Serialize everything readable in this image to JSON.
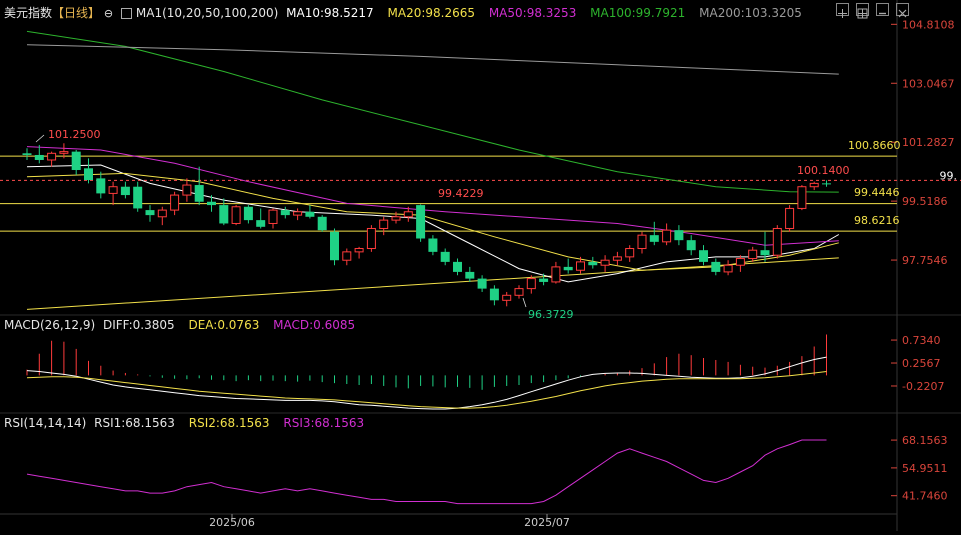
{
  "header": {
    "title": "美元指数",
    "period": "【日线】",
    "ma_title": "MA1(10,20,50,100,200)",
    "ma10": "MA10:98.5217",
    "ma20": "MA20:98.2665",
    "ma50": "MA50:98.3253",
    "ma100": "MA100:99.7921",
    "ma200": "MA200:103.3205"
  },
  "macd_header": {
    "title": "MACD(26,12,9)",
    "diff": "DIFF:0.3805",
    "dea": "DEA:0.0763",
    "macd": "MACD:0.6085"
  },
  "rsi_header": {
    "title": "RSI(14,14,14)",
    "rsi1": "RSI1:68.1563",
    "rsi2": "RSI2:68.1563",
    "rsi3": "RSI3:68.1563"
  },
  "colors": {
    "up": "#ff3b3b",
    "down": "#1fd185",
    "ma10": "#ffffff",
    "ma20": "#f2e04a",
    "ma50": "#d12fd1",
    "ma100": "#2db32d",
    "ma200": "#9a9a9a",
    "hline": "#f2e04a",
    "grid": "#2a2a2a"
  },
  "chart_data": [
    {
      "type": "candlestick",
      "name": "main",
      "x_labels": [
        "2025/06",
        "2025/07"
      ],
      "y_ticks": [
        "104.8108",
        "103.0467",
        "101.2827",
        "99.5186",
        "97.7546"
      ],
      "ylim": [
        96.2,
        105.0
      ],
      "annotations": [
        "101.2500",
        "99.4229",
        "96.3729",
        "100.1400",
        "100.8660",
        "99.4446",
        "98.6216"
      ],
      "horizontal_levels": [
        100.866,
        99.4446,
        98.6216
      ],
      "current_price": 100.14,
      "current_price_label": "99.",
      "support_trendline": {
        "from": [
          0,
          96.28
        ],
        "to": [
          66,
          97.82
        ]
      },
      "candles": [
        {
          "o": 100.95,
          "h": 101.1,
          "l": 100.75,
          "c": 100.9
        },
        {
          "o": 100.9,
          "h": 101.2,
          "l": 100.65,
          "c": 100.75
        },
        {
          "o": 100.75,
          "h": 101.0,
          "l": 100.55,
          "c": 100.95
        },
        {
          "o": 100.95,
          "h": 101.25,
          "l": 100.8,
          "c": 101.0
        },
        {
          "o": 101.0,
          "h": 101.05,
          "l": 100.3,
          "c": 100.45
        },
        {
          "o": 100.5,
          "h": 100.8,
          "l": 100.05,
          "c": 100.15
        },
        {
          "o": 100.2,
          "h": 100.4,
          "l": 99.6,
          "c": 99.75
        },
        {
          "o": 99.75,
          "h": 100.1,
          "l": 99.4,
          "c": 99.95
        },
        {
          "o": 99.95,
          "h": 100.1,
          "l": 99.6,
          "c": 99.7
        },
        {
          "o": 99.95,
          "h": 100.1,
          "l": 99.2,
          "c": 99.3
        },
        {
          "o": 99.25,
          "h": 99.4,
          "l": 98.9,
          "c": 99.1
        },
        {
          "o": 99.05,
          "h": 99.35,
          "l": 98.8,
          "c": 99.25
        },
        {
          "o": 99.25,
          "h": 99.8,
          "l": 99.1,
          "c": 99.7
        },
        {
          "o": 99.7,
          "h": 100.2,
          "l": 99.5,
          "c": 100.0
        },
        {
          "o": 100.0,
          "h": 100.55,
          "l": 99.4,
          "c": 99.5
        },
        {
          "o": 99.5,
          "h": 99.7,
          "l": 99.2,
          "c": 99.4
        },
        {
          "o": 99.4,
          "h": 99.6,
          "l": 98.8,
          "c": 98.85
        },
        {
          "o": 98.85,
          "h": 99.4,
          "l": 98.8,
          "c": 99.35
        },
        {
          "o": 99.35,
          "h": 99.4,
          "l": 98.85,
          "c": 98.95
        },
        {
          "o": 98.95,
          "h": 99.3,
          "l": 98.7,
          "c": 98.75
        },
        {
          "o": 98.85,
          "h": 99.3,
          "l": 98.7,
          "c": 99.25
        },
        {
          "o": 99.25,
          "h": 99.35,
          "l": 99.0,
          "c": 99.1
        },
        {
          "o": 99.1,
          "h": 99.3,
          "l": 98.95,
          "c": 99.2
        },
        {
          "o": 99.2,
          "h": 99.4,
          "l": 99.0,
          "c": 99.05
        },
        {
          "o": 99.05,
          "h": 99.1,
          "l": 98.6,
          "c": 98.65
        },
        {
          "o": 98.6,
          "h": 98.7,
          "l": 97.6,
          "c": 97.75
        },
        {
          "o": 97.75,
          "h": 98.1,
          "l": 97.6,
          "c": 98.0
        },
        {
          "o": 98.0,
          "h": 98.15,
          "l": 97.8,
          "c": 98.1
        },
        {
          "o": 98.1,
          "h": 98.8,
          "l": 98.0,
          "c": 98.7
        },
        {
          "o": 98.7,
          "h": 99.05,
          "l": 98.5,
          "c": 98.95
        },
        {
          "o": 98.95,
          "h": 99.2,
          "l": 98.85,
          "c": 99.05
        },
        {
          "o": 99.05,
          "h": 99.35,
          "l": 98.9,
          "c": 99.2
        },
        {
          "o": 99.4,
          "h": 99.42,
          "l": 98.3,
          "c": 98.4
        },
        {
          "o": 98.4,
          "h": 98.5,
          "l": 97.9,
          "c": 98.0
        },
        {
          "o": 98.0,
          "h": 98.1,
          "l": 97.6,
          "c": 97.7
        },
        {
          "o": 97.7,
          "h": 97.8,
          "l": 97.3,
          "c": 97.4
        },
        {
          "o": 97.4,
          "h": 97.55,
          "l": 97.1,
          "c": 97.2
        },
        {
          "o": 97.2,
          "h": 97.3,
          "l": 96.8,
          "c": 96.9
        },
        {
          "o": 96.9,
          "h": 97.0,
          "l": 96.4,
          "c": 96.55
        },
        {
          "o": 96.55,
          "h": 96.8,
          "l": 96.37,
          "c": 96.7
        },
        {
          "o": 96.7,
          "h": 97.0,
          "l": 96.6,
          "c": 96.9
        },
        {
          "o": 96.9,
          "h": 97.3,
          "l": 96.75,
          "c": 97.2
        },
        {
          "o": 97.2,
          "h": 97.35,
          "l": 97.0,
          "c": 97.1
        },
        {
          "o": 97.1,
          "h": 97.7,
          "l": 97.05,
          "c": 97.55
        },
        {
          "o": 97.55,
          "h": 97.8,
          "l": 97.35,
          "c": 97.45
        },
        {
          "o": 97.45,
          "h": 97.85,
          "l": 97.35,
          "c": 97.7
        },
        {
          "o": 97.7,
          "h": 97.85,
          "l": 97.5,
          "c": 97.6
        },
        {
          "o": 97.6,
          "h": 97.9,
          "l": 97.4,
          "c": 97.75
        },
        {
          "o": 97.75,
          "h": 98.0,
          "l": 97.6,
          "c": 97.85
        },
        {
          "o": 97.85,
          "h": 98.2,
          "l": 97.7,
          "c": 98.1
        },
        {
          "o": 98.1,
          "h": 98.6,
          "l": 97.95,
          "c": 98.5
        },
        {
          "o": 98.5,
          "h": 98.9,
          "l": 98.2,
          "c": 98.3
        },
        {
          "o": 98.3,
          "h": 98.85,
          "l": 98.2,
          "c": 98.65
        },
        {
          "o": 98.65,
          "h": 98.8,
          "l": 98.2,
          "c": 98.35
        },
        {
          "o": 98.35,
          "h": 98.5,
          "l": 97.9,
          "c": 98.05
        },
        {
          "o": 98.05,
          "h": 98.2,
          "l": 97.6,
          "c": 97.7
        },
        {
          "o": 97.7,
          "h": 97.8,
          "l": 97.3,
          "c": 97.4
        },
        {
          "o": 97.4,
          "h": 97.75,
          "l": 97.3,
          "c": 97.6
        },
        {
          "o": 97.6,
          "h": 97.9,
          "l": 97.4,
          "c": 97.8
        },
        {
          "o": 97.8,
          "h": 98.15,
          "l": 97.7,
          "c": 98.05
        },
        {
          "o": 98.05,
          "h": 98.6,
          "l": 97.7,
          "c": 97.9
        },
        {
          "o": 97.9,
          "h": 98.8,
          "l": 97.8,
          "c": 98.7
        },
        {
          "o": 98.7,
          "h": 99.4,
          "l": 98.6,
          "c": 99.3
        },
        {
          "o": 99.3,
          "h": 100.0,
          "l": 99.25,
          "c": 99.95
        },
        {
          "o": 99.95,
          "h": 100.1,
          "l": 99.85,
          "c": 100.05
        },
        {
          "o": 100.05,
          "h": 100.14,
          "l": 99.95,
          "c": 100.02
        }
      ],
      "ma_series": [
        {
          "name": "MA10",
          "color": "#ffffff",
          "points": [
            [
              0,
              100.55
            ],
            [
              6,
              100.6
            ],
            [
              10,
              100.05
            ],
            [
              16,
              99.55
            ],
            [
              22,
              99.2
            ],
            [
              28,
              99.1
            ],
            [
              32,
              99.0
            ],
            [
              36,
              98.25
            ],
            [
              40,
              97.5
            ],
            [
              44,
              97.1
            ],
            [
              48,
              97.35
            ],
            [
              52,
              97.7
            ],
            [
              56,
              97.85
            ],
            [
              60,
              97.85
            ],
            [
              64,
              98.1
            ],
            [
              66,
              98.52
            ]
          ]
        },
        {
          "name": "MA20",
          "color": "#f2e04a",
          "points": [
            [
              0,
              100.25
            ],
            [
              8,
              100.35
            ],
            [
              14,
              100.1
            ],
            [
              20,
              99.6
            ],
            [
              26,
              99.2
            ],
            [
              32,
              99.1
            ],
            [
              38,
              98.45
            ],
            [
              44,
              97.85
            ],
            [
              50,
              97.45
            ],
            [
              56,
              97.55
            ],
            [
              62,
              97.9
            ],
            [
              66,
              98.27
            ]
          ]
        },
        {
          "name": "MA50",
          "color": "#d12fd1",
          "points": [
            [
              0,
              101.15
            ],
            [
              6,
              101.05
            ],
            [
              12,
              100.65
            ],
            [
              18,
              100.1
            ],
            [
              26,
              99.45
            ],
            [
              34,
              99.2
            ],
            [
              40,
              99.05
            ],
            [
              48,
              98.85
            ],
            [
              54,
              98.55
            ],
            [
              60,
              98.2
            ],
            [
              66,
              98.33
            ]
          ]
        },
        {
          "name": "MA100",
          "color": "#2db32d",
          "points": [
            [
              0,
              104.6
            ],
            [
              8,
              104.15
            ],
            [
              16,
              103.4
            ],
            [
              24,
              102.55
            ],
            [
              32,
              101.8
            ],
            [
              40,
              101.05
            ],
            [
              48,
              100.4
            ],
            [
              56,
              99.95
            ],
            [
              62,
              99.8
            ],
            [
              66,
              99.79
            ]
          ]
        },
        {
          "name": "MA200",
          "color": "#9a9a9a",
          "points": [
            [
              0,
              104.2
            ],
            [
              16,
              104.05
            ],
            [
              32,
              103.85
            ],
            [
              48,
              103.6
            ],
            [
              66,
              103.32
            ]
          ]
        }
      ]
    },
    {
      "type": "bar+line",
      "name": "macd",
      "y_ticks": [
        "0.7340",
        "0.2567",
        "-0.2207"
      ],
      "ylim": [
        -0.72,
        0.86
      ],
      "histogram": [
        0.12,
        0.45,
        0.72,
        0.7,
        0.55,
        0.3,
        0.2,
        0.1,
        0.05,
        0.02,
        -0.02,
        -0.05,
        -0.07,
        -0.08,
        -0.06,
        -0.09,
        -0.1,
        -0.12,
        -0.1,
        -0.12,
        -0.11,
        -0.12,
        -0.13,
        -0.11,
        -0.14,
        -0.16,
        -0.18,
        -0.2,
        -0.18,
        -0.22,
        -0.25,
        -0.27,
        -0.22,
        -0.23,
        -0.25,
        -0.24,
        -0.26,
        -0.3,
        -0.24,
        -0.22,
        -0.2,
        -0.16,
        -0.14,
        -0.1,
        -0.06,
        -0.02,
        0.0,
        0.03,
        0.06,
        0.1,
        0.15,
        0.25,
        0.38,
        0.45,
        0.42,
        0.36,
        0.32,
        0.28,
        0.22,
        0.18,
        0.16,
        0.2,
        0.28,
        0.4,
        0.6,
        0.85
      ],
      "diff": [
        0.1,
        0.08,
        0.05,
        0.02,
        -0.02,
        -0.08,
        -0.14,
        -0.2,
        -0.24,
        -0.27,
        -0.3,
        -0.33,
        -0.36,
        -0.39,
        -0.42,
        -0.44,
        -0.46,
        -0.48,
        -0.49,
        -0.5,
        -0.51,
        -0.52,
        -0.52,
        -0.52,
        -0.53,
        -0.55,
        -0.58,
        -0.61,
        -0.62,
        -0.64,
        -0.66,
        -0.68,
        -0.69,
        -0.7,
        -0.7,
        -0.68,
        -0.65,
        -0.61,
        -0.56,
        -0.5,
        -0.42,
        -0.34,
        -0.26,
        -0.18,
        -0.1,
        -0.03,
        0.02,
        0.04,
        0.05,
        0.05,
        0.04,
        0.02,
        0.0,
        -0.02,
        -0.04,
        -0.05,
        -0.06,
        -0.06,
        -0.05,
        -0.02,
        0.03,
        0.1,
        0.18,
        0.26,
        0.33,
        0.38
      ],
      "dea": [
        -0.05,
        -0.04,
        -0.03,
        -0.03,
        -0.04,
        -0.06,
        -0.09,
        -0.12,
        -0.15,
        -0.18,
        -0.21,
        -0.24,
        -0.27,
        -0.3,
        -0.33,
        -0.35,
        -0.37,
        -0.39,
        -0.41,
        -0.43,
        -0.45,
        -0.47,
        -0.48,
        -0.49,
        -0.5,
        -0.51,
        -0.53,
        -0.55,
        -0.57,
        -0.59,
        -0.61,
        -0.63,
        -0.65,
        -0.66,
        -0.67,
        -0.68,
        -0.68,
        -0.67,
        -0.65,
        -0.62,
        -0.58,
        -0.54,
        -0.49,
        -0.44,
        -0.38,
        -0.32,
        -0.27,
        -0.22,
        -0.18,
        -0.15,
        -0.12,
        -0.1,
        -0.08,
        -0.07,
        -0.07,
        -0.07,
        -0.07,
        -0.07,
        -0.07,
        -0.06,
        -0.05,
        -0.03,
        -0.01,
        0.02,
        0.05,
        0.08
      ]
    },
    {
      "type": "line",
      "name": "rsi",
      "y_ticks": [
        "68.1563",
        "54.9511",
        "41.7460"
      ],
      "ylim": [
        34,
        72
      ],
      "values": [
        52,
        51,
        50,
        49,
        48,
        47,
        46,
        45,
        44,
        44,
        43,
        43,
        44,
        46,
        47,
        48,
        46,
        45,
        44,
        43,
        44,
        45,
        44,
        45,
        44,
        43,
        42,
        41,
        40,
        40,
        39,
        39,
        39,
        39,
        39,
        38,
        38,
        38,
        38,
        38,
        38,
        38,
        39,
        42,
        46,
        50,
        54,
        58,
        62,
        64,
        62,
        60,
        58,
        55,
        52,
        49,
        48,
        50,
        53,
        56,
        61,
        64,
        66,
        68.2,
        68.2,
        68.2
      ]
    }
  ]
}
